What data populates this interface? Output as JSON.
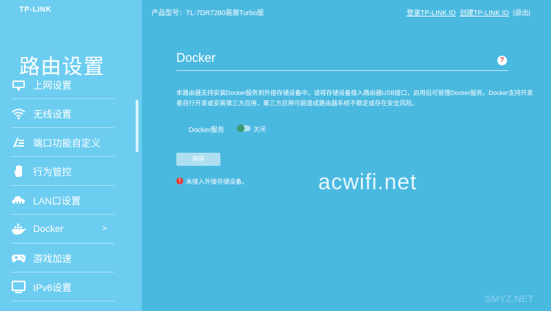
{
  "brand": {
    "logo_text": "TP-LINK"
  },
  "sidebar": {
    "title": "路由设置",
    "items": [
      {
        "label": "上网设置",
        "icon": "internet-icon"
      },
      {
        "label": "无线设置",
        "icon": "wifi-icon"
      },
      {
        "label": "端口功能自定义",
        "icon": "port-config-icon"
      },
      {
        "label": "行为管控",
        "icon": "hand-icon"
      },
      {
        "label": "LAN口设置",
        "icon": "cloud-icon"
      },
      {
        "label": "Docker",
        "icon": "docker-icon",
        "active": true,
        "chevron": ">"
      },
      {
        "label": "游戏加速",
        "icon": "gamepad-icon"
      },
      {
        "label": "IPv6设置",
        "icon": "monitor-icon"
      }
    ]
  },
  "header": {
    "model": "产品型号：TL-7DR7280易展Turbo版",
    "login": "登录TP-LINK ID",
    "create": "创建TP-LINK ID",
    "logout": "|退出|"
  },
  "main": {
    "title": "Docker",
    "help": "?",
    "description": "本路由器支持安装Docker服务到外接存储设备中。请将存储设备接入路由器USB接口，启用后可管理Docker服务。Docker支持开发者自行开发或安装第三方应用，第三方应用可能造成路由器系统不稳定或存在安全风险。",
    "service_label": "Docker服务",
    "toggle_state": "关闭",
    "save": "保存",
    "error": "未接入外接存储设备。",
    "error_glyph": "!"
  },
  "watermark": {
    "text": "acwifi.net",
    "corner": "SMYZ.NET"
  },
  "colors": {
    "sidebar": "#6ccdf0",
    "main": "#4ab9e0",
    "error": "#e53935",
    "toggle_knob": "#3a9a73"
  }
}
